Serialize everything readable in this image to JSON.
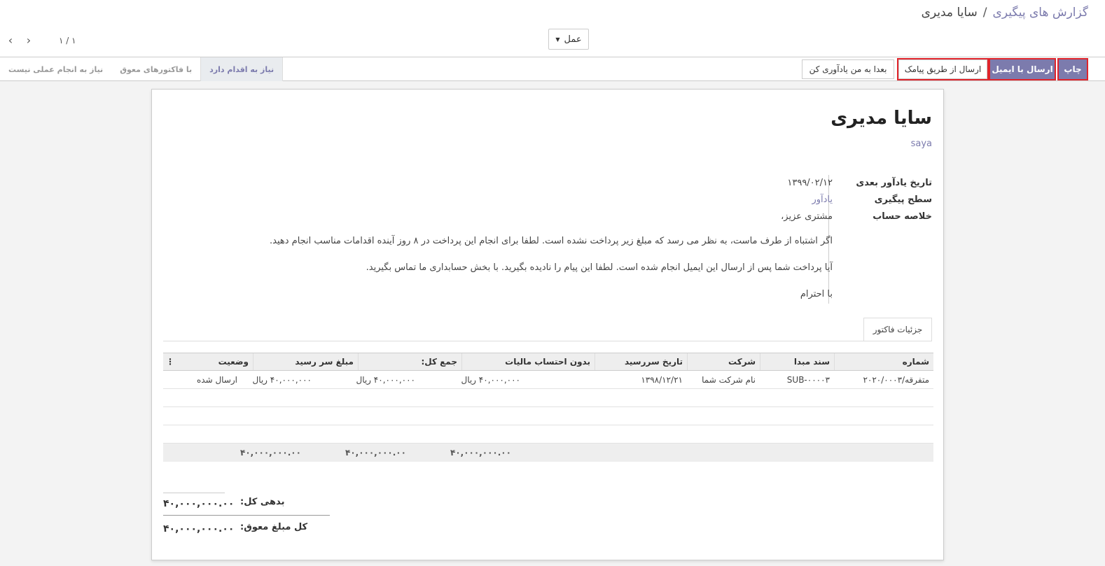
{
  "breadcrumb": {
    "parent": "گزارش های پیگیری",
    "separator": "/",
    "current": "سایا مدیری"
  },
  "pager": {
    "value": "۱ / ۱",
    "prev_icon": "chevron-left-icon",
    "next_icon": "chevron-right-icon"
  },
  "action_menu": {
    "label": "عمل",
    "icon": "caret-down-icon"
  },
  "buttons": {
    "print": "چاپ",
    "send_email": "ارسال با ایمیل",
    "send_sms": "ارسال از طریق پیامک",
    "remind_later": "بعدا به من یادآوری کن"
  },
  "stages": [
    "نیاز به اقدام دارد",
    "با فاکتورهای معوق",
    "نیاز به انجام عملی نیست"
  ],
  "active_stage": "نیاز به اقدام دارد",
  "record": {
    "title": "سایا مدیری",
    "partner_ref": "saya",
    "labels": {
      "next_reminder": "تاریخ یادآور بعدی",
      "followup_level": "سطح پیگیری",
      "account_summary": "خلاصه حساب"
    },
    "next_reminder_date": "۱۳۹۹/۰۲/۱۲",
    "followup_level": "یادآور",
    "summary": {
      "greeting": "مشتری عزیز،",
      "line1": "اگر اشتباه از طرف ماست، به نظر می رسد که مبلغ زیر پرداخت نشده است. لطفا برای انجام این پرداخت در ۸ روز آینده اقدامات مناسب انجام دهید.",
      "line2": "آیا پرداخت شما پس از ارسال این ایمیل انجام شده است. لطفا این پیام را نادیده بگیرید. با بخش حسابداری ما تماس بگیرید.",
      "closing": "با احترام"
    }
  },
  "tab": {
    "label": "جزئیات فاکتور"
  },
  "table": {
    "headers": {
      "number": "شماره",
      "source": "سند مبدا",
      "company": "شرکت",
      "due_date": "تاریخ سررسید",
      "untaxed": "بدون احتساب مالیات",
      "total": "جمع کل:",
      "amount_due": "مبلغ سر رسید",
      "status": "وضعیت"
    },
    "rows": [
      {
        "number": "متفرقه/۲۰۲۰/۰۰۰۳",
        "source": "SUB-۰۰۰۰۳",
        "company": "نام شرکت شما",
        "due_date": "۱۳۹۸/۱۲/۲۱",
        "untaxed": "۴۰,۰۰۰,۰۰۰ ریال",
        "total": "۴۰,۰۰۰,۰۰۰ ریال",
        "amount_due": "۴۰,۰۰۰,۰۰۰ ریال",
        "status": "ارسال شده"
      }
    ],
    "footer": {
      "untaxed": "۴۰,۰۰۰,۰۰۰.۰۰",
      "total": "۴۰,۰۰۰,۰۰۰.۰۰",
      "amount_due": "۴۰,۰۰۰,۰۰۰.۰۰"
    }
  },
  "totals": {
    "total_due_label": "بدهی کل:",
    "total_due": "۴۰,۰۰۰,۰۰۰.۰۰",
    "total_overdue_label": "کل مبلغ معوق:",
    "total_overdue": "۴۰,۰۰۰,۰۰۰.۰۰"
  },
  "colors": {
    "brand": "#7c7bad",
    "highlight": "#e0242b"
  }
}
